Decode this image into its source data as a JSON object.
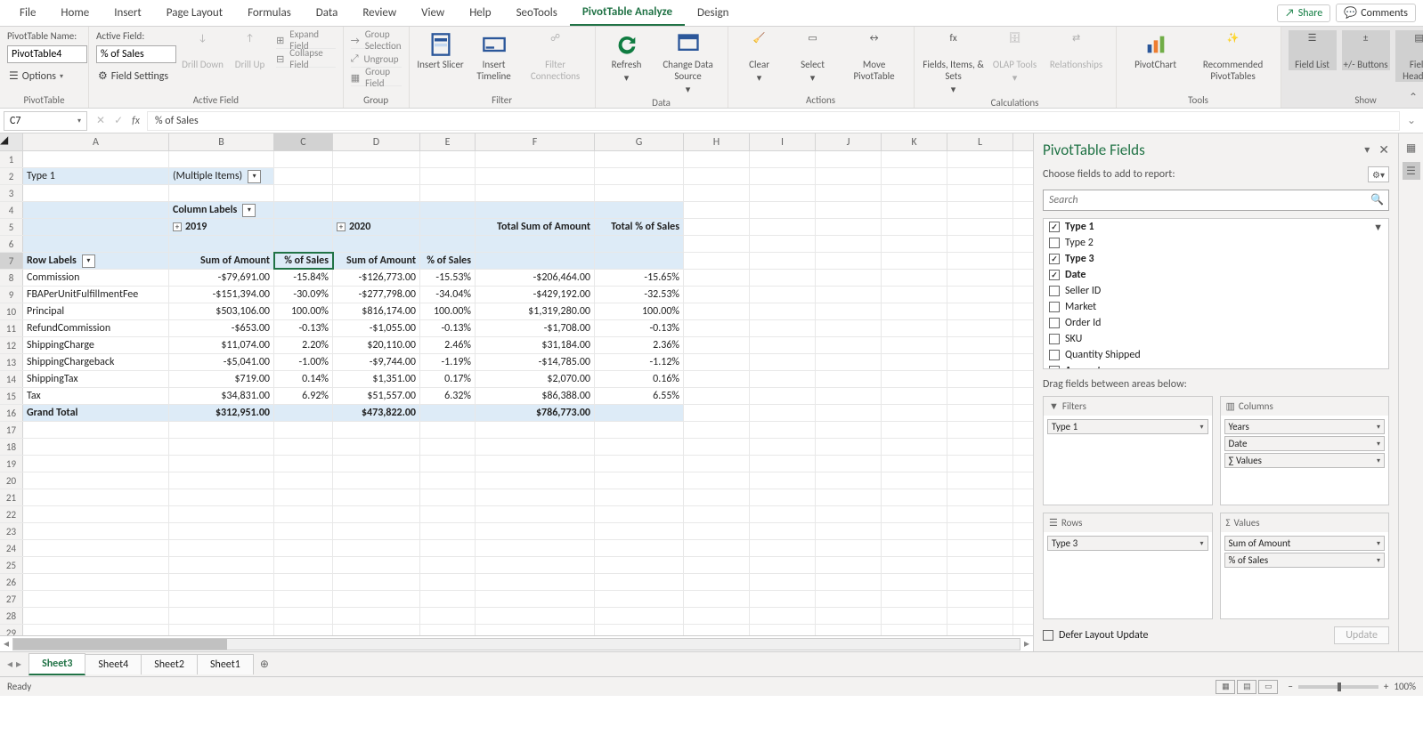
{
  "tabs": [
    "File",
    "Home",
    "Insert",
    "Page Layout",
    "Formulas",
    "Data",
    "Review",
    "View",
    "Help",
    "SeoTools",
    "PivotTable Analyze",
    "Design"
  ],
  "active_tab": "PivotTable Analyze",
  "top_right": {
    "share": "Share",
    "comments": "Comments"
  },
  "ribbon": {
    "pt_name_label": "PivotTable Name:",
    "pt_name_value": "PivotTable4",
    "options": "Options",
    "group1": "PivotTable",
    "active_field_label": "Active Field:",
    "active_field_value": "% of Sales",
    "field_settings": "Field Settings",
    "drill_down": "Drill Down",
    "drill_up": "Drill Up",
    "expand": "Expand Field",
    "collapse": "Collapse Field",
    "group2": "Active Field",
    "grp_selection": "Group Selection",
    "ungroup": "Ungroup",
    "grp_field": "Group Field",
    "group3": "Group",
    "insert_slicer": "Insert Slicer",
    "insert_timeline": "Insert Timeline",
    "filter_conn": "Filter Connections",
    "group4": "Filter",
    "refresh": "Refresh",
    "change_ds": "Change Data Source",
    "group5": "Data",
    "clear": "Clear",
    "select": "Select",
    "move": "Move PivotTable",
    "group6": "Actions",
    "fields_items": "Fields, Items, & Sets",
    "olap": "OLAP Tools",
    "relationships": "Relationships",
    "group7": "Calculations",
    "pivotchart": "PivotChart",
    "recommended": "Recommended PivotTables",
    "group8": "Tools",
    "field_list": "Field List",
    "pm_buttons": "+/- Buttons",
    "field_headers": "Field Headers",
    "group9": "Show"
  },
  "namebox": "C7",
  "formula": "% of Sales",
  "col_letters": [
    "A",
    "B",
    "C",
    "D",
    "E",
    "F",
    "G",
    "H",
    "I",
    "J",
    "K",
    "L"
  ],
  "sheet_tabs": [
    "Sheet3",
    "Sheet4",
    "Sheet2",
    "Sheet1"
  ],
  "active_sheet": "Sheet3",
  "status": "Ready",
  "zoom": "100%",
  "pivot": {
    "filter_field": "Type 1",
    "filter_value": "(Multiple Items)",
    "col_labels": "Column Labels",
    "y2019": "2019",
    "y2020": "2020",
    "tot_sum": "Total Sum of Amount",
    "tot_pct": "Total % of Sales",
    "row_labels": "Row Labels",
    "sum_amt": "Sum of Amount",
    "pct_sales": "% of Sales",
    "rows": [
      {
        "label": "Commission",
        "a19": "-$79,691.00",
        "p19": "-15.84%",
        "a20": "-$126,773.00",
        "p20": "-15.53%",
        "at": "-$206,464.00",
        "pt": "-15.65%"
      },
      {
        "label": "FBAPerUnitFulfillmentFee",
        "a19": "-$151,394.00",
        "p19": "-30.09%",
        "a20": "-$277,798.00",
        "p20": "-34.04%",
        "at": "-$429,192.00",
        "pt": "-32.53%"
      },
      {
        "label": "Principal",
        "a19": "$503,106.00",
        "p19": "100.00%",
        "a20": "$816,174.00",
        "p20": "100.00%",
        "at": "$1,319,280.00",
        "pt": "100.00%"
      },
      {
        "label": "RefundCommission",
        "a19": "-$653.00",
        "p19": "-0.13%",
        "a20": "-$1,055.00",
        "p20": "-0.13%",
        "at": "-$1,708.00",
        "pt": "-0.13%"
      },
      {
        "label": "ShippingCharge",
        "a19": "$11,074.00",
        "p19": "2.20%",
        "a20": "$20,110.00",
        "p20": "2.46%",
        "at": "$31,184.00",
        "pt": "2.36%"
      },
      {
        "label": "ShippingChargeback",
        "a19": "-$5,041.00",
        "p19": "-1.00%",
        "a20": "-$9,744.00",
        "p20": "-1.19%",
        "at": "-$14,785.00",
        "pt": "-1.12%"
      },
      {
        "label": "ShippingTax",
        "a19": "$719.00",
        "p19": "0.14%",
        "a20": "$1,351.00",
        "p20": "0.17%",
        "at": "$2,070.00",
        "pt": "0.16%"
      },
      {
        "label": "Tax",
        "a19": "$34,831.00",
        "p19": "6.92%",
        "a20": "$51,557.00",
        "p20": "6.32%",
        "at": "$86,388.00",
        "pt": "6.55%"
      }
    ],
    "grand_total": "Grand Total",
    "gt": {
      "a19": "$312,951.00",
      "a20": "$473,822.00",
      "at": "$786,773.00"
    }
  },
  "field_pane": {
    "title": "PivotTable Fields",
    "choose": "Choose fields to add to report:",
    "search": "Search",
    "fields": [
      {
        "name": "Type 1",
        "checked": true,
        "bold": true,
        "filter": true
      },
      {
        "name": "Type 2",
        "checked": false
      },
      {
        "name": "Type 3",
        "checked": true,
        "bold": true
      },
      {
        "name": "Date",
        "checked": true,
        "bold": true
      },
      {
        "name": "Seller ID",
        "checked": false
      },
      {
        "name": "Market",
        "checked": false
      },
      {
        "name": "Order Id",
        "checked": false
      },
      {
        "name": "SKU",
        "checked": false
      },
      {
        "name": "Quantity Shipped",
        "checked": false
      },
      {
        "name": "Amount",
        "checked": true,
        "bold": true
      }
    ],
    "drag": "Drag fields between areas below:",
    "filters": "Filters",
    "columns": "Columns",
    "rows": "Rows",
    "values": "Values",
    "filter_items": [
      "Type 1"
    ],
    "col_items": [
      "Years",
      "Date",
      "∑ Values"
    ],
    "row_items": [
      "Type 3"
    ],
    "val_items": [
      "Sum of Amount",
      "% of Sales"
    ],
    "defer": "Defer Layout Update",
    "update": "Update"
  }
}
